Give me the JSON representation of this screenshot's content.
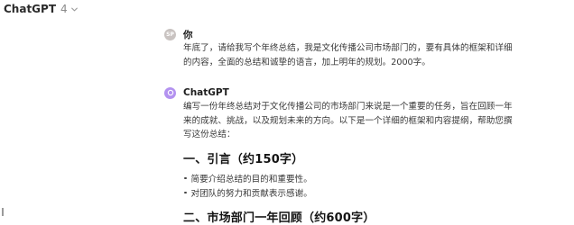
{
  "header": {
    "model_name": "ChatGPT",
    "model_version": "4"
  },
  "user_message": {
    "avatar_initials": "SP",
    "author": "你",
    "text": "年底了，请给我写个年终总结，我是文化传播公司市场部门的，要有具体的框架和详细\n的内容，全面的总结和诚挚的语言，加上明年的规划。2000字。"
  },
  "assistant_message": {
    "author": "ChatGPT",
    "intro": "编写一份年终总结对于文化传播公司的市场部门来说是一个重要的任务，旨在回顾一年\n来的成就、挑战，以及规划未来的方向。以下是一个详细的框架和内容提纲，帮助您撰\n写这份总结：",
    "sections": [
      {
        "heading": "一、引言（约150字）",
        "bullets": [
          "简要介绍总结的目的和重要性。",
          "对团队的努力和贡献表示感谢。"
        ]
      },
      {
        "heading": "二、市场部门一年回顾（约600字）",
        "bullets": []
      }
    ]
  },
  "colors": {
    "user_avatar": "#c9c3c1",
    "gpt_avatar": "#b392f0"
  },
  "icons": {
    "model_dropdown": "chevron-down-icon",
    "gpt_avatar": "openai-logo-icon"
  }
}
